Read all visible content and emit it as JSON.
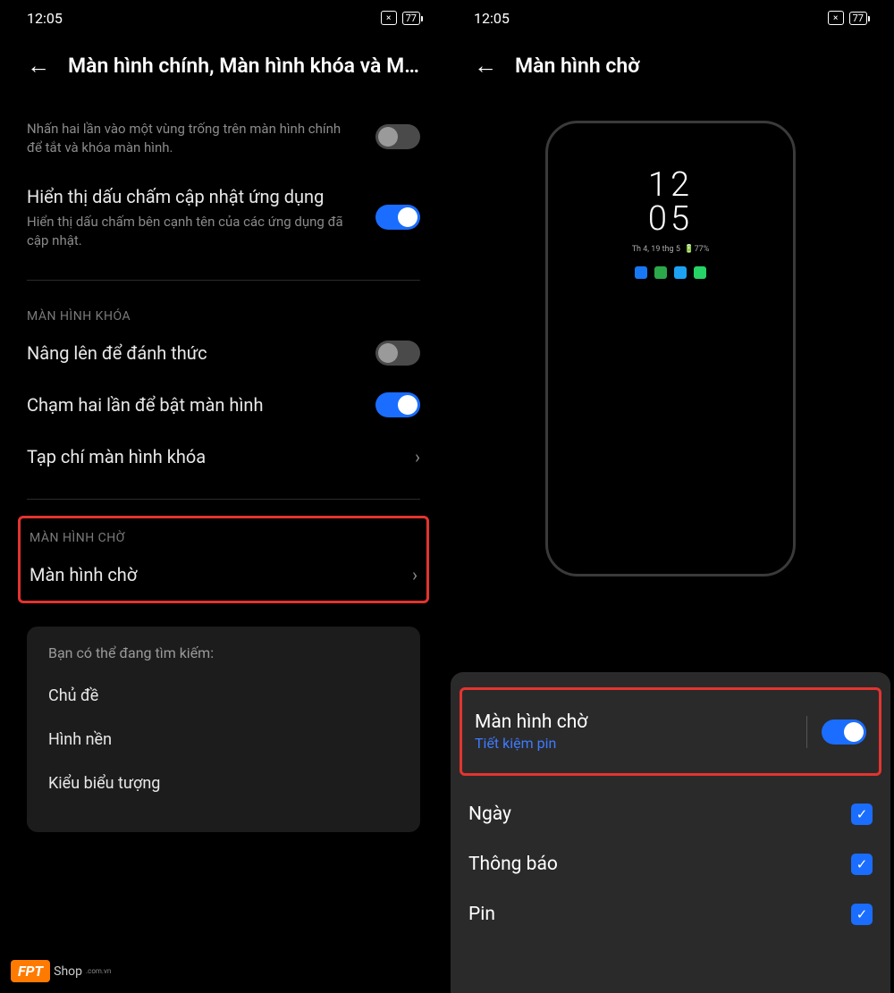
{
  "status": {
    "time": "12:05",
    "battery": "77"
  },
  "left": {
    "title": "Màn hình chính, Màn hình khóa và Mà…",
    "row1_title": "Nhấn hai lần vào một vùng trống trên màn hình chính để tắt và khóa màn hình.",
    "row2_title": "Hiển thị dấu chấm cập nhật ứng dụng",
    "row2_desc": "Hiển thị dấu chấm bên cạnh tên của các ứng dụng đã cập nhật.",
    "section_lock": "MÀN HÌNH KHÓA",
    "row3_title": "Nâng lên để đánh thức",
    "row4_title": "Chạm hai lần để bật màn hình",
    "row5_title": "Tạp chí màn hình khóa",
    "section_aod": "MÀN HÌNH CHỜ",
    "row6_title": "Màn hình chờ",
    "suggestions_title": "Bạn có thể đang tìm kiếm:",
    "sug1": "Chủ đề",
    "sug2": "Hình nền",
    "sug3": "Kiểu biểu tượng"
  },
  "right": {
    "title": "Màn hình chờ",
    "clock_hour": "12",
    "clock_min": "05",
    "phone_date": "Th 4, 19 thg 5",
    "phone_batt": "77%",
    "aod_title": "Màn hình chờ",
    "aod_sub": "Tiết kiệm pin",
    "opt1": "Ngày",
    "opt2": "Thông báo",
    "opt3": "Pin"
  },
  "watermark": {
    "brand": "FPT",
    "text": "Shop",
    "sub": ".com.vn"
  }
}
